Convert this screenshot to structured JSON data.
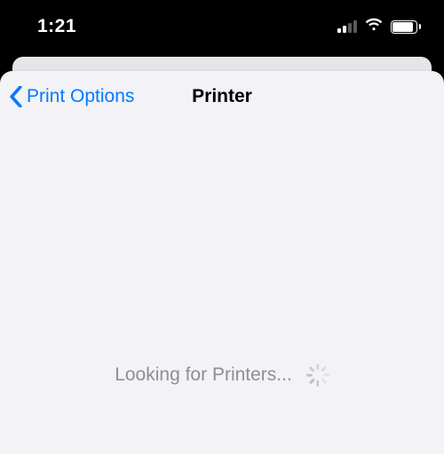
{
  "status": {
    "time": "1:21",
    "cellular_active_bars": 2,
    "cellular_total_bars": 4
  },
  "nav": {
    "back_label": "Print Options",
    "title": "Printer"
  },
  "content": {
    "searching_label": "Looking for Printers..."
  },
  "colors": {
    "accent": "#007aff",
    "sheet_bg": "#f2f2f7",
    "secondary_text": "#8e8e93"
  }
}
